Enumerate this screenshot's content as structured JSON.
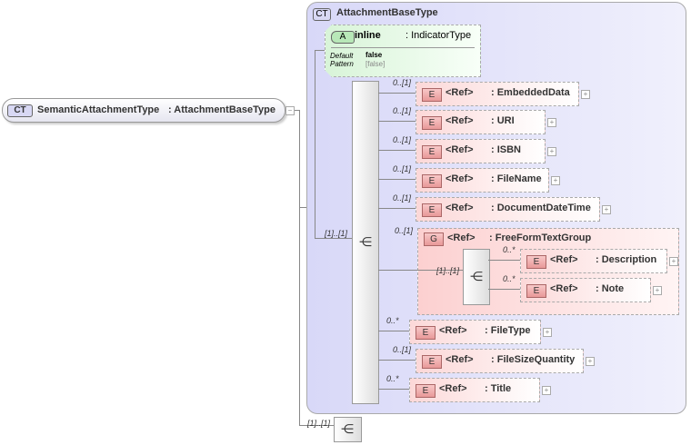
{
  "root": {
    "badge": "CT",
    "name": "SemanticAttachmentType",
    "type": ": AttachmentBaseType",
    "collapse": "−"
  },
  "base": {
    "badge": "CT",
    "name": "AttachmentBaseType"
  },
  "attribute": {
    "badge": "A",
    "name": "inline",
    "type": ": IndicatorType",
    "default_label": "Default",
    "default_value": "false",
    "pattern_label": "Pattern",
    "pattern_value": "[false]"
  },
  "sequence_card": "[1]..[1]",
  "bottom_sequence_card": "[1]..[1]",
  "elements": [
    {
      "card": "0..[1]",
      "badge": "E",
      "ref": "<Ref>",
      "type": ": EmbeddedData"
    },
    {
      "card": "0..[1]",
      "badge": "E",
      "ref": "<Ref>",
      "type": ": URI"
    },
    {
      "card": "0..[1]",
      "badge": "E",
      "ref": "<Ref>",
      "type": ": ISBN"
    },
    {
      "card": "0..[1]",
      "badge": "E",
      "ref": "<Ref>",
      "type": ": FileName"
    },
    {
      "card": "0..[1]",
      "badge": "E",
      "ref": "<Ref>",
      "type": ": DocumentDateTime"
    },
    {
      "card": "0..*",
      "badge": "E",
      "ref": "<Ref>",
      "type": ": FileType"
    },
    {
      "card": "0..[1]",
      "badge": "E",
      "ref": "<Ref>",
      "type": ": FileSizeQuantity"
    },
    {
      "card": "0..*",
      "badge": "E",
      "ref": "<Ref>",
      "type": ": Title"
    }
  ],
  "group": {
    "card": "0..[1]",
    "badge": "G",
    "ref": "<Ref>",
    "type": ": FreeFormTextGroup",
    "seq_card": "[1]..[1]",
    "elements": [
      {
        "card": "0..*",
        "badge": "E",
        "ref": "<Ref>",
        "type": ": Description"
      },
      {
        "card": "0..*",
        "badge": "E",
        "ref": "<Ref>",
        "type": ": Note"
      }
    ]
  },
  "plus": "+"
}
